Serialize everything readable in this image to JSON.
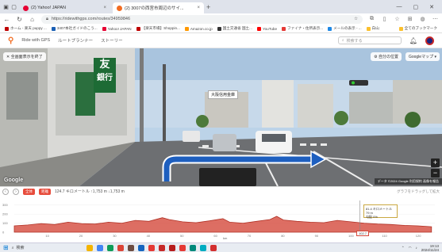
{
  "browser": {
    "tabs": [
      {
        "label": "(2) Yahoo! JAPAN",
        "favicon_color": "#e60033",
        "active": false
      },
      {
        "label": "(2) 3007の西宮市周辺のサイ...",
        "favicon_color": "#f26b21",
        "active": true
      }
    ],
    "new_tab": "+",
    "url": "https://ridewithgps.com/routes/34959846",
    "bookmarks": [
      {
        "label": "ホーム - 楽天 puppy ...",
        "color": "#bf0000"
      },
      {
        "label": "3407本社ガイドのこう...",
        "color": "#1a5fb4"
      },
      {
        "label": "Yahoo! JAPAN",
        "color": "#e60033"
      },
      {
        "label": "【楽天市場】Shoppin...",
        "color": "#bf0000"
      },
      {
        "label": "Amazon.co.jp",
        "color": "#ff9900"
      },
      {
        "label": "国土交通省 国土...",
        "color": "#333333"
      },
      {
        "label": "YouTube",
        "color": "#ff0000"
      },
      {
        "label": "ファイナ・住所表示...",
        "color": "#e53935"
      },
      {
        "label": "メールの表示 - ...",
        "color": "#1e88e5"
      },
      {
        "label": "白山",
        "color": "#fbc02d"
      }
    ],
    "bookmarks_more": "全てのブックマーク"
  },
  "site": {
    "nav": [
      "Ride with GPS",
      "ルートプランナー",
      "ストーリー"
    ],
    "search_placeholder": "検索する"
  },
  "streetview": {
    "back_label": "全画面表示を終了",
    "top_right_label": "自分の位置",
    "map_type": "Googleマップ",
    "google_mark": "Google",
    "footer": "データ ©2024 Google  利用規約  画像を報告",
    "shop_sign_1": "友",
    "shop_sign_2": "銀行",
    "building_sign": "大阪信用金庫"
  },
  "elevation": {
    "header": "124.7 キロメートル ↑1,753 m ↓1,753 m",
    "btn_1": "全体",
    "btn_2": "距離",
    "right_label": "グラフをドラッグして拡大",
    "tooltip_line_1": "81.4 キロメートル 79 m",
    "tooltip_line_2": "勾配 0%",
    "y_ticks": [
      "300",
      "200",
      "100",
      "0"
    ],
    "x_ticks": [
      "10",
      "20",
      "30",
      "40",
      "50",
      "60",
      "70",
      "80",
      "90",
      "100",
      "110",
      "120"
    ],
    "x_unit": "km",
    "marker_label": "102.7"
  },
  "elevation_chart": {
    "type": "area",
    "xlim": [
      0,
      125
    ],
    "ylim": [
      0,
      350
    ],
    "color": "#c0392b",
    "points": [
      [
        0,
        70
      ],
      [
        4,
        80
      ],
      [
        8,
        95
      ],
      [
        12,
        85
      ],
      [
        16,
        110
      ],
      [
        20,
        95
      ],
      [
        24,
        90
      ],
      [
        28,
        110
      ],
      [
        32,
        100
      ],
      [
        36,
        130
      ],
      [
        40,
        120
      ],
      [
        44,
        160
      ],
      [
        46,
        140
      ],
      [
        50,
        115
      ],
      [
        54,
        105
      ],
      [
        58,
        125
      ],
      [
        62,
        150
      ],
      [
        64,
        110
      ],
      [
        68,
        100
      ],
      [
        72,
        120
      ],
      [
        76,
        140
      ],
      [
        78,
        175
      ],
      [
        80,
        135
      ],
      [
        84,
        120
      ],
      [
        88,
        110
      ],
      [
        92,
        105
      ],
      [
        96,
        130
      ],
      [
        100,
        115
      ],
      [
        104,
        100
      ],
      [
        108,
        90
      ],
      [
        112,
        85
      ],
      [
        116,
        75
      ],
      [
        120,
        70
      ],
      [
        124,
        60
      ]
    ]
  },
  "taskbar": {
    "search": "検索",
    "time": "19:13",
    "date": "2024/11/24",
    "icons": [
      "#f4b400",
      "#4285f4",
      "#0f9d58",
      "#db4437",
      "#6d4c41",
      "#1565c0",
      "#e53935",
      "#c62828",
      "#b71c1c",
      "#e53935",
      "#00897b",
      "#00acc1",
      "#d32f2f"
    ]
  }
}
